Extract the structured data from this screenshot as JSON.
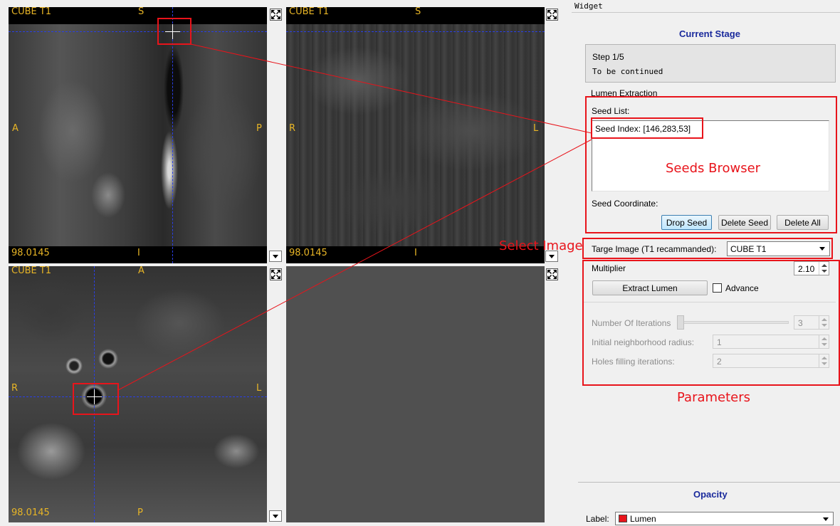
{
  "viewers": {
    "top_left": {
      "series": "CUBE T1",
      "top": "S",
      "left": "A",
      "right": "P",
      "bottom": "I",
      "value": "98.0145"
    },
    "top_right": {
      "series": "CUBE T1",
      "top": "S",
      "left": "R",
      "right": "L",
      "bottom": "I",
      "value": "98.0145"
    },
    "bottom_left": {
      "series": "CUBE T1",
      "top": "A",
      "left": "R",
      "right": "L",
      "bottom": "P",
      "value": "98.0145"
    }
  },
  "panel": {
    "dock_title": "Widget",
    "current_stage_title": "Current Stage",
    "step": "Step 1/5",
    "step_note": "To be continued",
    "section_title": "Lumen Extraction",
    "seed_list_label": "Seed List:",
    "seed_entry": "Seed Index: [146,283,53]",
    "seed_coordinate_label": "Seed Coordinate:",
    "drop_seed": "Drop Seed",
    "delete_seed": "Delete Seed",
    "delete_all": "Delete All",
    "target_image_label": "Targe Image (T1 recammanded):",
    "target_image_value": "CUBE T1",
    "multiplier_label": "Multiplier",
    "multiplier_value": "2.10",
    "extract_lumen": "Extract Lumen",
    "advance_label": "Advance",
    "advance_checked": false,
    "iterations_label": "Number Of Iterations",
    "iterations_value": "3",
    "radius_label": "Initial neighborhood radius:",
    "radius_value": "1",
    "holes_label": "Holes filling iterations:",
    "holes_value": "2",
    "opacity_title": "Opacity",
    "label_label": "Label:",
    "label_value": "Lumen",
    "label_color": "#e8141b"
  },
  "annotations": {
    "seeds_browser": "Seeds Browser",
    "select_image": "Select Image",
    "parameters": "Parameters"
  },
  "colors": {
    "overlay_text": "#e8b526",
    "crosshair": "#2a3fe6",
    "annotation": "#e8141b",
    "heading": "#1a2a9c"
  }
}
